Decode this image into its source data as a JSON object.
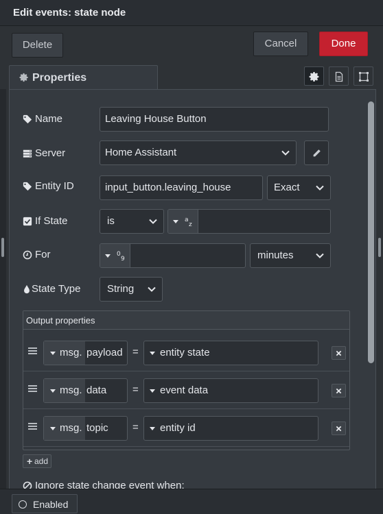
{
  "window": {
    "title": "Edit events: state node"
  },
  "toolbar": {
    "delete_label": "Delete",
    "cancel_label": "Cancel",
    "done_label": "Done"
  },
  "tabs": {
    "properties_label": "Properties"
  },
  "colors": {
    "done": "#c4212f",
    "panel": "#353a40",
    "field": "#2b2f34"
  },
  "form": {
    "name": {
      "label": "Name",
      "value": "Leaving House Button"
    },
    "server": {
      "label": "Server",
      "value": "Home Assistant"
    },
    "entity_id": {
      "label": "Entity ID",
      "value": "input_button.leaving_house",
      "match": "Exact"
    },
    "if_state": {
      "label": "If State",
      "operator": "is",
      "value": ""
    },
    "for": {
      "label": "For",
      "value": "",
      "unit": "minutes"
    },
    "state_type": {
      "label": "State Type",
      "value": "String"
    }
  },
  "output": {
    "header": "Output properties",
    "rows": [
      {
        "prefix": "msg.",
        "property": "payload",
        "eq": "=",
        "value": "entity state"
      },
      {
        "prefix": "msg.",
        "property": "data",
        "eq": "=",
        "value": "event data"
      },
      {
        "prefix": "msg.",
        "property": "topic",
        "eq": "=",
        "value": "entity id"
      }
    ],
    "add_label": "add"
  },
  "ignore_label": "Ignore state change event when:",
  "footer": {
    "enabled_label": "Enabled"
  }
}
